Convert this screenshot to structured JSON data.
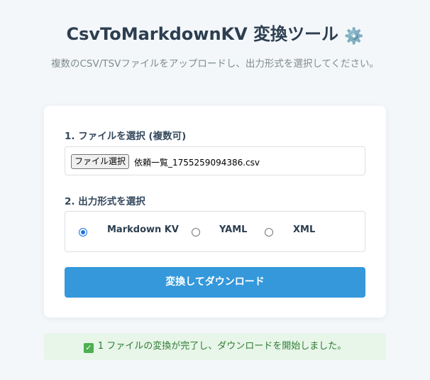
{
  "header": {
    "title": "CsvToMarkdownKV 変換ツール",
    "title_icon": "gear-icon",
    "subtitle": "複数のCSV/TSVファイルをアップロードし、出力形式を選択してください。"
  },
  "file_section": {
    "label": "1. ファイルを選択 (複数可)",
    "button_label": "ファイル選択",
    "selected_file": "依頼一覧_1755259094386.csv"
  },
  "format_section": {
    "label": "2. 出力形式を選択",
    "options": [
      {
        "label": "Markdown KV",
        "checked": true
      },
      {
        "label": "YAML",
        "checked": false
      },
      {
        "label": "XML",
        "checked": false
      }
    ]
  },
  "convert_button": {
    "label": "変換してダウンロード"
  },
  "status": {
    "icon": "check-mark-icon",
    "message": "1 ファイルの変換が完了し、ダウンロードを開始しました。"
  },
  "colors": {
    "accent": "#3498db",
    "background": "#f4f7fa",
    "success_bg": "#e8f5e9",
    "success_text": "#2e7d32"
  }
}
